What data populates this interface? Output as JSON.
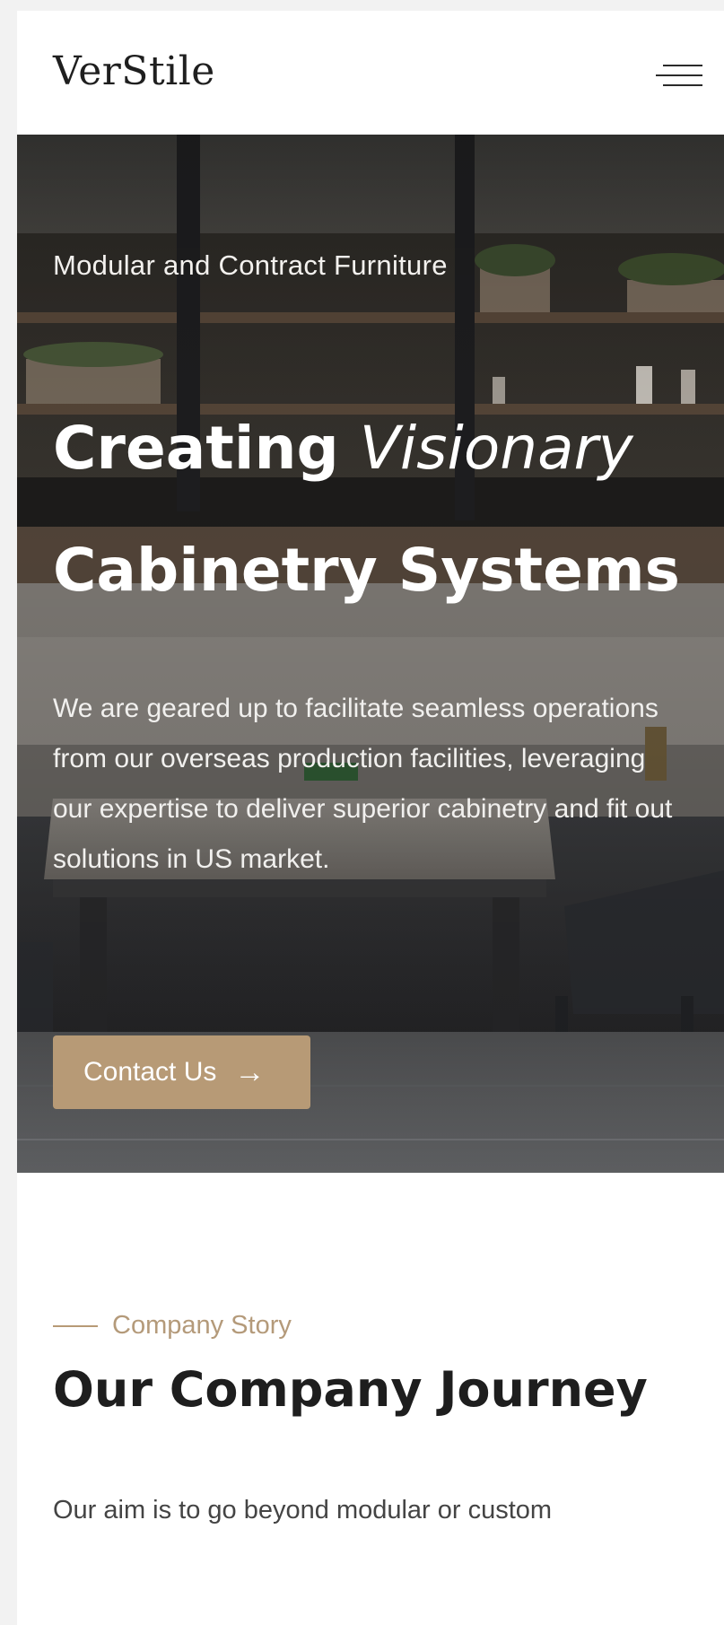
{
  "header": {
    "logo": "VerStile",
    "menu_icon": "hamburger-menu-icon"
  },
  "hero": {
    "eyebrow": "Modular and Contract Furniture",
    "headline_line1_strong": "Creating",
    "headline_line1_light": "Visionary",
    "headline_line2": "Cabinetry Systems",
    "description": "We are geared up to facilitate seamless operations from our overseas production facilities, leveraging our expertise to deliver superior cabinetry and fit out solutions in US market.",
    "cta_label": "Contact Us",
    "cta_arrow": "→",
    "swipe_left": "←",
    "swipe_right": "→",
    "swipe_icon": "hand-swipe-icon"
  },
  "story": {
    "tag": "Company Story",
    "title": "Our Company Journey",
    "text": "Our aim is to go beyond modular or custom"
  },
  "colors": {
    "accent": "#b79a76",
    "heading": "#1e1e1e",
    "background": "#ffffff"
  }
}
